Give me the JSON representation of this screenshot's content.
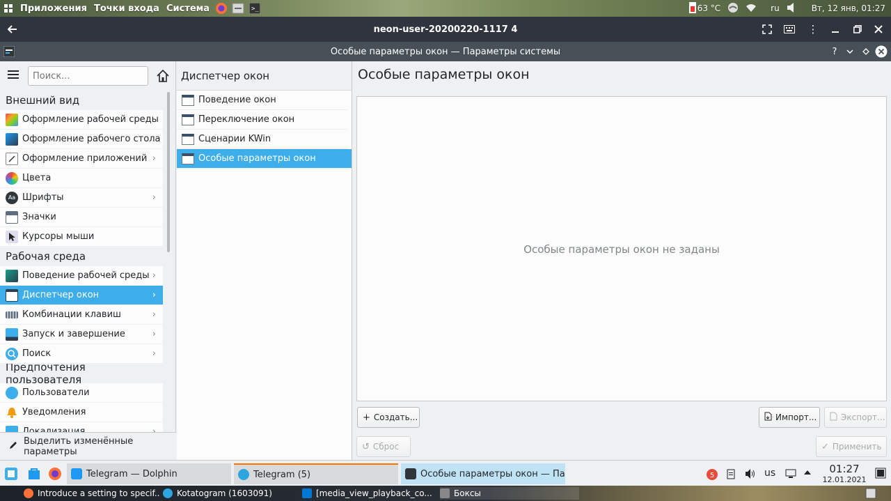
{
  "top_panel": {
    "menus": [
      "Приложения",
      "Точки входа",
      "Система"
    ],
    "temperature": "63 °C",
    "keyboard_layout": "ru",
    "datetime": "Вт, 12 янв, 01:27"
  },
  "vm_window": {
    "title": "neon-user-20200220-1117 4"
  },
  "kde_window": {
    "title": "Особые параметры окон — Параметры системы"
  },
  "sidebar": {
    "search_placeholder": "Поиск...",
    "sections": [
      {
        "title": "Внешний вид",
        "items": [
          {
            "label": "Оформление рабочей среды",
            "icon": "workspace-theme-icon",
            "chevron": false
          },
          {
            "label": "Оформление рабочего стола",
            "icon": "desktop-theme-icon",
            "chevron": false
          },
          {
            "label": "Оформление приложений",
            "icon": "app-style-icon",
            "chevron": true
          },
          {
            "label": "Цвета",
            "icon": "colors-icon",
            "chevron": false
          },
          {
            "label": "Шрифты",
            "icon": "fonts-icon",
            "chevron": true
          },
          {
            "label": "Значки",
            "icon": "icons-icon",
            "chevron": false
          },
          {
            "label": "Курсоры мыши",
            "icon": "cursor-icon",
            "chevron": false
          }
        ]
      },
      {
        "title": "Рабочая среда",
        "items": [
          {
            "label": "Поведение рабочей среды",
            "icon": "workspace-behavior-icon",
            "chevron": true
          },
          {
            "label": "Диспетчер окон",
            "icon": "window-manager-icon",
            "chevron": true,
            "selected": true
          },
          {
            "label": "Комбинации клавиш",
            "icon": "keyboard-icon",
            "chevron": true
          },
          {
            "label": "Запуск и завершение",
            "icon": "startup-icon",
            "chevron": true
          },
          {
            "label": "Поиск",
            "icon": "search-icon",
            "chevron": true
          }
        ]
      },
      {
        "title": "Предпочтения пользователя",
        "items": [
          {
            "label": "Пользователи",
            "icon": "users-icon",
            "chevron": false
          },
          {
            "label": "Уведомления",
            "icon": "bell-icon",
            "chevron": false
          },
          {
            "label": "Локализация",
            "icon": "locale-icon",
            "chevron": true
          }
        ]
      }
    ],
    "highlight_button": "Выделить изменённые параметры"
  },
  "middle": {
    "header": "Диспетчер окон",
    "items": [
      {
        "label": "Поведение окон",
        "selected": false
      },
      {
        "label": "Переключение окон",
        "selected": false
      },
      {
        "label": "Сценарии KWin",
        "selected": false
      },
      {
        "label": "Особые параметры окон",
        "selected": true
      }
    ]
  },
  "main": {
    "title": "Особые параметры окон",
    "empty_message": "Особые параметры окон не заданы",
    "create_button": "Создать...",
    "import_button": "Импорт...",
    "export_button": "Экспорт...",
    "reset_button": "Сброс",
    "apply_button": "Применить"
  },
  "taskbar": {
    "tasks": [
      {
        "label": "Telegram — Dolphin"
      },
      {
        "label": "Telegram (5)"
      },
      {
        "label": "Особые параметры окон — Пар..."
      }
    ],
    "telegram_badge": "5",
    "keyboard_layout": "us",
    "time": "01:27",
    "date": "12.01.2021"
  },
  "host_bar": {
    "tasks": [
      {
        "label": "Introduce a setting to specif..."
      },
      {
        "label": "Kotatogram (1603091)"
      },
      {
        "label": "[media_view_playback_co..."
      },
      {
        "label": "Боксы"
      }
    ]
  },
  "colors": {
    "accent": "#3daee9",
    "title_bar": "#475057",
    "vm_bar": "#2f343f"
  }
}
